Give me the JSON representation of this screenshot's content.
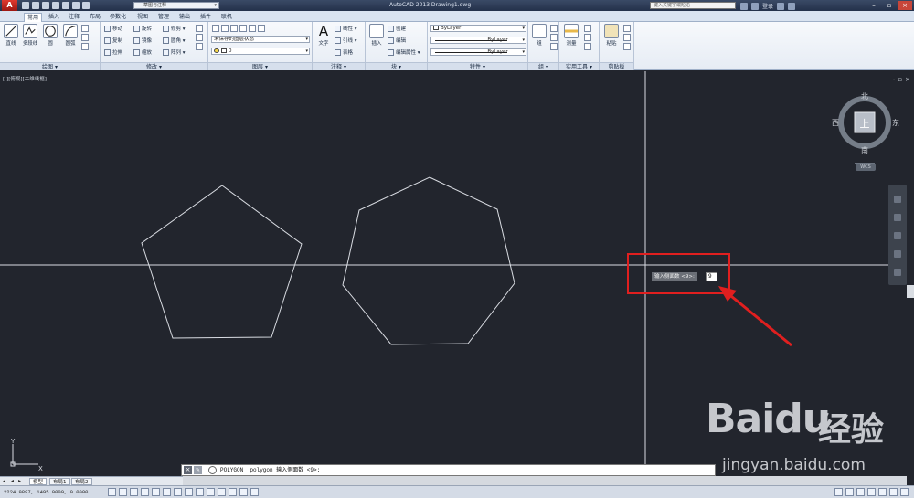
{
  "titlebar": {
    "logo": "A",
    "workspace": "草图与注释",
    "title": "AutoCAD 2013    Drawing1.dwg",
    "search_placeholder": "键入关键字或短语",
    "login": "登录"
  },
  "ribbon_tabs": [
    "常用",
    "插入",
    "注释",
    "布局",
    "参数化",
    "视图",
    "管理",
    "输出",
    "插件",
    "联机"
  ],
  "ribbon": {
    "draw": {
      "footer": "绘图",
      "line": "直线",
      "polyline": "多段线",
      "circle": "圆",
      "arc": "圆弧"
    },
    "modify": {
      "footer": "修改",
      "move": "移动",
      "rotate": "旋转",
      "trim": "修剪",
      "copy": "复制",
      "mirror": "镜像",
      "fillet": "圆角",
      "stretch": "拉伸",
      "scale": "缩放",
      "array": "阵列"
    },
    "layers": {
      "footer": "图层",
      "state": "未保存的图层状态",
      "current": "0"
    },
    "annotation": {
      "footer": "注释",
      "text": "文字",
      "linear": "线性",
      "leader": "引线",
      "table": "表格"
    },
    "block": {
      "footer": "块",
      "insert": "插入",
      "create": "创建",
      "edit": "编辑",
      "edit_attr": "编辑属性"
    },
    "properties": {
      "footer": "特性",
      "color": "ByLayer",
      "linetype": "ByLayer",
      "lineweight": "ByLayer"
    },
    "groups": {
      "footer": "组",
      "group": "组"
    },
    "utilities": {
      "footer": "实用工具",
      "measure": "测量"
    },
    "clipboard": {
      "footer": "剪贴板",
      "paste": "粘贴"
    }
  },
  "viewport": {
    "label": "[-][俯视][二维线框]",
    "controls": [
      "-",
      "▫",
      "×"
    ]
  },
  "viewcube": {
    "north": "北",
    "south": "南",
    "east": "东",
    "west": "西",
    "face": "上",
    "wcs": "WCS"
  },
  "prompt": {
    "label": "输入侧面数 <9>:",
    "value": "9"
  },
  "ucs": {
    "x": "X",
    "y": "Y"
  },
  "command_line": {
    "close": "×",
    "text": "POLYGON _polygon 输入侧面数 <9>:"
  },
  "layout_tabs": [
    "模型",
    "布局1",
    "布局2"
  ],
  "status": {
    "coords": "2224.9897, 1495.0009, 0.0000"
  },
  "watermark": {
    "brand": "Baidu",
    "jingyan": "经验",
    "url": "jingyan.baidu.com"
  },
  "colors": {
    "canvas": "#22252d",
    "highlight": "#e01f1f",
    "geometry": "#d9dce2"
  }
}
